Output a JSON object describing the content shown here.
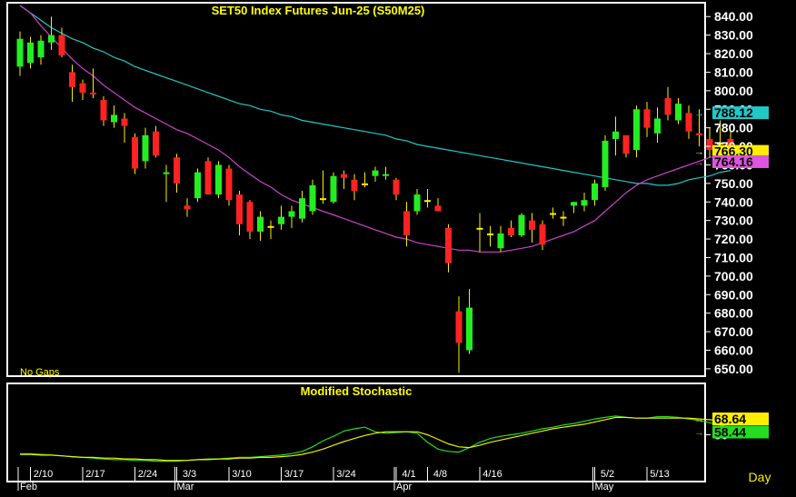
{
  "chart_data": [
    {
      "type": "candlestick",
      "title": "SET50  Index  Futures  Jun-25  (S50M25)",
      "note": "No  Gaps",
      "ylim": [
        647,
        846
      ],
      "y_ticks": [
        650,
        660,
        670,
        680,
        690,
        700,
        710,
        720,
        730,
        740,
        750,
        760,
        770,
        780,
        790,
        800,
        810,
        820,
        830,
        840
      ],
      "grid": false,
      "colors": {
        "up": "#22ee22",
        "down": "#ff2222",
        "neutral": "#ffee00",
        "ma_long": "#20c8c8",
        "ma_short": "#cc44cc"
      },
      "candles": [
        {
          "o": 813,
          "h": 832,
          "l": 808,
          "c": 828
        },
        {
          "o": 815,
          "h": 829,
          "l": 812,
          "c": 826
        },
        {
          "o": 818,
          "h": 830,
          "l": 814,
          "c": 827
        },
        {
          "o": 826,
          "h": 840,
          "l": 822,
          "c": 830
        },
        {
          "o": 830,
          "h": 834,
          "l": 818,
          "c": 819
        },
        {
          "o": 810,
          "h": 814,
          "l": 794,
          "c": 802
        },
        {
          "o": 804,
          "h": 806,
          "l": 795,
          "c": 799
        },
        {
          "o": 799,
          "h": 812,
          "l": 796,
          "c": 798
        },
        {
          "o": 795,
          "h": 797,
          "l": 781,
          "c": 784
        },
        {
          "o": 783,
          "h": 792,
          "l": 780,
          "c": 787
        },
        {
          "o": 785,
          "h": 788,
          "l": 772,
          "c": 781
        },
        {
          "o": 775,
          "h": 777,
          "l": 755,
          "c": 758
        },
        {
          "o": 762,
          "h": 780,
          "l": 758,
          "c": 776
        },
        {
          "o": 778,
          "h": 781,
          "l": 764,
          "c": 765
        },
        {
          "o": 755,
          "h": 760,
          "l": 740,
          "c": 756
        },
        {
          "o": 764,
          "h": 766,
          "l": 745,
          "c": 750
        },
        {
          "o": 738,
          "h": 742,
          "l": 732,
          "c": 736
        },
        {
          "o": 742,
          "h": 758,
          "l": 740,
          "c": 756
        },
        {
          "o": 762,
          "h": 764,
          "l": 744,
          "c": 744
        },
        {
          "o": 744,
          "h": 762,
          "l": 742,
          "c": 760
        },
        {
          "o": 758,
          "h": 760,
          "l": 738,
          "c": 741
        },
        {
          "o": 744,
          "h": 746,
          "l": 722,
          "c": 728
        },
        {
          "o": 740,
          "h": 741,
          "l": 720,
          "c": 724
        },
        {
          "o": 724,
          "h": 735,
          "l": 719,
          "c": 732
        },
        {
          "o": 727,
          "h": 730,
          "l": 720,
          "c": 727
        },
        {
          "o": 728,
          "h": 738,
          "l": 725,
          "c": 732
        },
        {
          "o": 732,
          "h": 738,
          "l": 726,
          "c": 735
        },
        {
          "o": 731,
          "h": 746,
          "l": 729,
          "c": 742
        },
        {
          "o": 735,
          "h": 752,
          "l": 733,
          "c": 749
        },
        {
          "o": 742,
          "h": 757,
          "l": 739,
          "c": 742
        },
        {
          "o": 740,
          "h": 756,
          "l": 739,
          "c": 754
        },
        {
          "o": 755,
          "h": 757,
          "l": 747,
          "c": 753
        },
        {
          "o": 752,
          "h": 755,
          "l": 741,
          "c": 746
        },
        {
          "o": 750,
          "h": 756,
          "l": 748,
          "c": 750
        },
        {
          "o": 754,
          "h": 759,
          "l": 751,
          "c": 757
        },
        {
          "o": 754,
          "h": 759,
          "l": 752,
          "c": 755
        },
        {
          "o": 752,
          "h": 753,
          "l": 741,
          "c": 744
        },
        {
          "o": 735,
          "h": 740,
          "l": 716,
          "c": 722
        },
        {
          "o": 735,
          "h": 747,
          "l": 733,
          "c": 744
        },
        {
          "o": 741,
          "h": 747,
          "l": 737,
          "c": 741
        },
        {
          "o": 738,
          "h": 742,
          "l": 735,
          "c": 735
        },
        {
          "o": 726,
          "h": 728,
          "l": 702,
          "c": 707
        },
        {
          "o": 681,
          "h": 689,
          "l": 648,
          "c": 664
        },
        {
          "o": 660,
          "h": 693,
          "l": 658,
          "c": 683
        },
        {
          "o": 726,
          "h": 734,
          "l": 713,
          "c": 726
        },
        {
          "o": 723,
          "h": 727,
          "l": 716,
          "c": 723
        },
        {
          "o": 715,
          "h": 727,
          "l": 713,
          "c": 723
        },
        {
          "o": 726,
          "h": 730,
          "l": 721,
          "c": 722
        },
        {
          "o": 722,
          "h": 734,
          "l": 721,
          "c": 733
        },
        {
          "o": 730,
          "h": 734,
          "l": 718,
          "c": 725
        },
        {
          "o": 728,
          "h": 730,
          "l": 714,
          "c": 717
        },
        {
          "o": 734,
          "h": 737,
          "l": 731,
          "c": 734
        },
        {
          "o": 732,
          "h": 735,
          "l": 727,
          "c": 732
        },
        {
          "o": 738,
          "h": 740,
          "l": 734,
          "c": 740
        },
        {
          "o": 738,
          "h": 745,
          "l": 735,
          "c": 741
        },
        {
          "o": 741,
          "h": 752,
          "l": 738,
          "c": 750
        },
        {
          "o": 748,
          "h": 776,
          "l": 746,
          "c": 773
        },
        {
          "o": 774,
          "h": 786,
          "l": 765,
          "c": 778
        },
        {
          "o": 776,
          "h": 776,
          "l": 764,
          "c": 766
        },
        {
          "o": 768,
          "h": 792,
          "l": 764,
          "c": 790
        },
        {
          "o": 790,
          "h": 794,
          "l": 775,
          "c": 780
        },
        {
          "o": 777,
          "h": 791,
          "l": 772,
          "c": 785
        },
        {
          "o": 796,
          "h": 802,
          "l": 784,
          "c": 787
        },
        {
          "o": 784,
          "h": 796,
          "l": 782,
          "c": 793
        },
        {
          "o": 788,
          "h": 792,
          "l": 774,
          "c": 778
        },
        {
          "o": 777,
          "h": 790,
          "l": 770,
          "c": 776
        },
        {
          "o": 774,
          "h": 780,
          "l": 764,
          "c": 768
        },
        {
          "o": 772,
          "h": 784,
          "l": 768,
          "c": 772
        },
        {
          "o": 774,
          "h": 779,
          "l": 762,
          "c": 763
        }
      ],
      "ma_long": [
        846,
        842,
        838,
        834,
        831,
        828,
        826,
        823,
        821,
        818,
        816,
        813,
        811,
        809,
        807,
        805,
        803,
        801,
        799,
        797,
        795,
        793,
        792,
        790,
        789,
        787,
        786,
        784,
        783,
        782,
        781,
        780,
        779,
        778,
        777,
        776,
        774,
        773,
        771,
        770,
        769,
        768,
        767,
        766,
        765,
        764,
        763,
        762,
        761,
        760,
        759,
        758,
        757,
        756,
        755,
        754,
        753,
        752,
        751,
        750,
        750,
        749,
        749,
        750,
        752,
        753,
        754,
        756,
        757
      ],
      "ma_short": [
        846,
        842,
        835,
        829,
        823,
        817,
        812,
        808,
        803,
        799,
        795,
        791,
        788,
        785,
        782,
        779,
        777,
        774,
        771,
        768,
        764,
        759,
        755,
        751,
        748,
        744,
        741,
        739,
        737,
        735,
        733,
        731,
        729,
        727,
        725,
        723,
        721,
        720,
        718,
        717,
        716,
        715,
        714,
        714,
        713,
        713,
        713,
        714,
        715,
        716,
        718,
        720,
        722,
        724,
        727,
        730,
        735,
        740,
        745,
        749,
        752,
        754,
        756,
        758,
        760,
        762,
        764,
        765,
        766
      ],
      "last_values": [
        {
          "text": "788.12",
          "value": 788.12,
          "color": "#20c8c8"
        },
        {
          "text": "766.30",
          "value": 766.3,
          "color": "#ffee00"
        },
        {
          "text": "764.16",
          "value": 764.16,
          "color": "#dd55dd"
        }
      ],
      "x_ticks": [
        {
          "i": 1,
          "label": "2/10"
        },
        {
          "i": 6,
          "label": "2/17"
        },
        {
          "i": 11,
          "label": "2/24"
        },
        {
          "i": 15,
          "label": "3/3"
        },
        {
          "i": 20,
          "label": "3/10"
        },
        {
          "i": 25,
          "label": "3/17"
        },
        {
          "i": 30,
          "label": "3/24"
        },
        {
          "i": 36,
          "label": "4/1"
        },
        {
          "i": 39,
          "label": "4/8"
        },
        {
          "i": 44,
          "label": "4/16"
        },
        {
          "i": 55,
          "label": "5/2"
        },
        {
          "i": 60,
          "label": "5/13"
        }
      ],
      "month_labels": [
        {
          "i": 0,
          "label": "Feb"
        },
        {
          "i": 15,
          "label": "Mar"
        },
        {
          "i": 36,
          "label": "Apr"
        },
        {
          "i": 55,
          "label": "May"
        }
      ],
      "xlabel": "Day"
    },
    {
      "type": "line",
      "title": "Modified  Stochastic",
      "ylim": [
        0,
        100
      ],
      "y_ticks": [
        50
      ],
      "series": [
        {
          "color": "#22dd22",
          "values": [
            25,
            25,
            24,
            23,
            22,
            21,
            20,
            19,
            18,
            17,
            17,
            16,
            16,
            15,
            15,
            15,
            16,
            17,
            18,
            18,
            19,
            20,
            20,
            21,
            22,
            23,
            25,
            28,
            34,
            42,
            48,
            55,
            58,
            60,
            54,
            52,
            53,
            54,
            52,
            40,
            31,
            28,
            27,
            33,
            40,
            45,
            48,
            50,
            52,
            55,
            58,
            60,
            63,
            65,
            68,
            71,
            73,
            75,
            73,
            72,
            72,
            74,
            74,
            73,
            71,
            69,
            66,
            63,
            60
          ]
        },
        {
          "color": "#eeee00",
          "values": [
            24,
            24,
            23,
            23,
            22,
            21,
            20,
            20,
            19,
            19,
            18,
            18,
            17,
            17,
            16,
            16,
            16,
            17,
            17,
            18,
            18,
            19,
            19,
            20,
            20,
            21,
            22,
            24,
            27,
            31,
            36,
            41,
            45,
            49,
            52,
            54,
            54,
            54,
            54,
            50,
            44,
            38,
            34,
            33,
            36,
            40,
            43,
            46,
            49,
            52,
            55,
            58,
            60,
            62,
            64,
            67,
            70,
            73,
            73,
            72,
            72,
            72,
            72,
            72,
            72,
            71,
            70,
            68,
            66
          ]
        }
      ],
      "last_values": [
        {
          "text": "68.64",
          "value": 68.64,
          "color": "#ffee00"
        },
        {
          "text": "58.44",
          "value": 58.44,
          "color": "#22dd22"
        }
      ]
    }
  ]
}
